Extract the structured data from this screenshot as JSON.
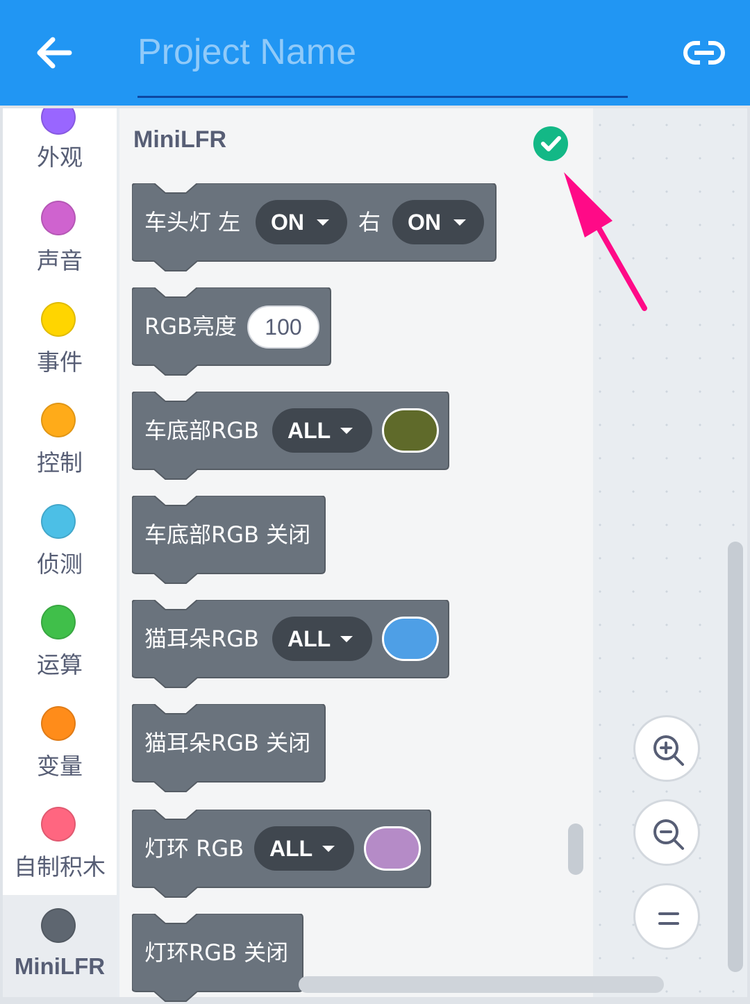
{
  "header": {
    "title_placeholder": "Project Name",
    "back_icon": "arrow-left-icon",
    "link_icon": "link-icon"
  },
  "categories": [
    {
      "label": "外观",
      "color": "#9966ff"
    },
    {
      "label": "声音",
      "color": "#cf63cf"
    },
    {
      "label": "事件",
      "color": "#ffd500"
    },
    {
      "label": "控制",
      "color": "#ffab19"
    },
    {
      "label": "侦测",
      "color": "#4cbfe6"
    },
    {
      "label": "运算",
      "color": "#40bf4a"
    },
    {
      "label": "变量",
      "color": "#ff8c1a"
    },
    {
      "label": "自制积木",
      "color": "#ff6680"
    },
    {
      "label": "MiniLFR",
      "color": "#5e6670",
      "selected": true
    }
  ],
  "flyout": {
    "title": "MiniLFR",
    "status_icon": "check-circle-icon",
    "blocks": {
      "headlights": {
        "text": "车头灯 左",
        "right_text": "右",
        "left_value": "ON",
        "right_value": "ON"
      },
      "rgb_brightness": {
        "text": "RGB亮度",
        "value": "100"
      },
      "bottom_rgb": {
        "text": "车底部RGB",
        "value": "ALL",
        "color": "#5f6a2a"
      },
      "bottom_rgb_off": {
        "text": "车底部RGB 关闭"
      },
      "ear_rgb": {
        "text": "猫耳朵RGB",
        "value": "ALL",
        "color": "#4e9fe6"
      },
      "ear_rgb_off": {
        "text": "猫耳朵RGB 关闭"
      },
      "ring_rgb": {
        "text": "灯环 RGB",
        "value": "ALL",
        "color": "#b58bc7"
      },
      "ring_rgb_off": {
        "text": "灯环RGB 关闭"
      }
    }
  },
  "zoom": {
    "in_icon": "zoom-in-icon",
    "out_icon": "zoom-out-icon",
    "reset_icon": "zoom-reset-icon"
  },
  "colors": {
    "header": "#2196f3",
    "block": "#6a737d",
    "pill": "#40474f",
    "check": "#13b886",
    "annotation": "#ff0a87"
  }
}
